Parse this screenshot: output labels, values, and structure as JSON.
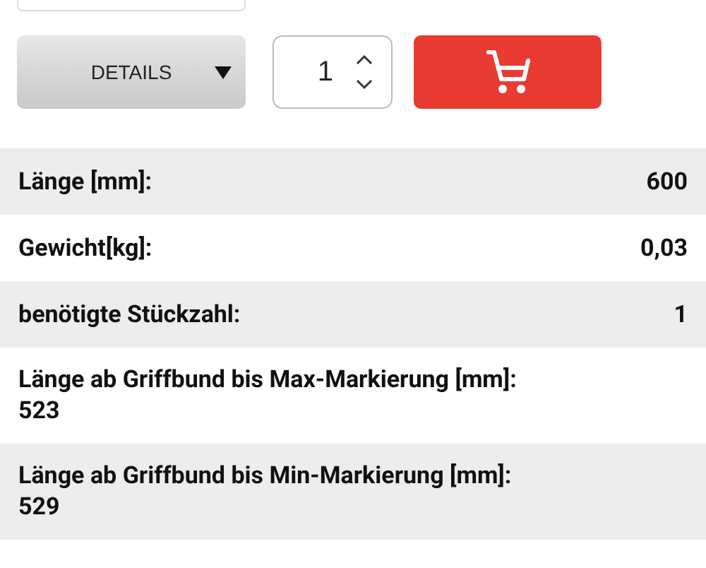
{
  "details_button": {
    "label": "DETAILS"
  },
  "quantity": {
    "value": "1"
  },
  "specs": [
    {
      "kind": "inline",
      "label": "Länge [mm]:",
      "value": "600"
    },
    {
      "kind": "inline",
      "label": "Gewicht[kg]:",
      "value": "0,03"
    },
    {
      "kind": "inline",
      "label": "benötigte Stückzahl:",
      "value": "1"
    },
    {
      "kind": "stacked",
      "label": "Länge ab Griffbund bis Max-Markierung [mm]:",
      "value": "523"
    },
    {
      "kind": "stacked",
      "label": "Länge ab Griffbund bis Min-Markierung [mm]:",
      "value": "529"
    }
  ]
}
